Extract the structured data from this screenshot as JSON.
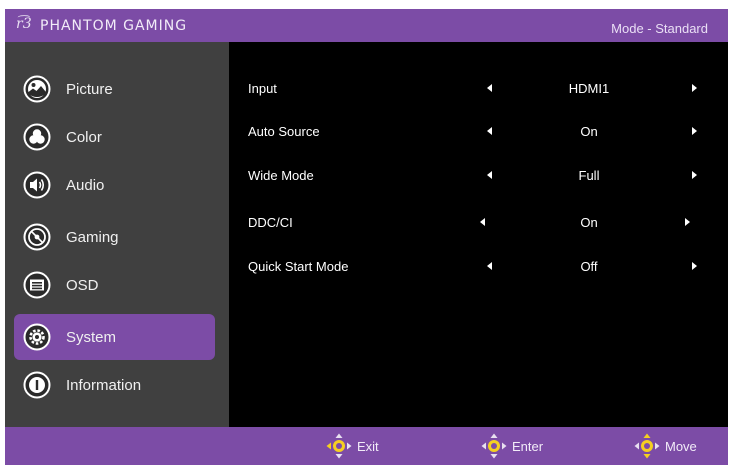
{
  "header": {
    "brand_mark": "r͡3",
    "brand_name": "PHANTOM GAMING",
    "mode": "Mode - Standard"
  },
  "sidebar": {
    "items": [
      {
        "label": "Picture",
        "icon": "picture-icon",
        "active": false
      },
      {
        "label": "Color",
        "icon": "color-icon",
        "active": false
      },
      {
        "label": "Audio",
        "icon": "audio-icon",
        "active": false
      },
      {
        "label": "Gaming",
        "icon": "gaming-icon",
        "active": false
      },
      {
        "label": "OSD",
        "icon": "osd-icon",
        "active": false
      },
      {
        "label": "System",
        "icon": "system-gear-icon",
        "active": true
      },
      {
        "label": "Information",
        "icon": "information-icon",
        "active": false
      }
    ]
  },
  "settings": [
    {
      "label": "Input",
      "value": "HDMI1"
    },
    {
      "label": "Auto Source",
      "value": "On"
    },
    {
      "label": "Wide Mode",
      "value": "Full"
    },
    {
      "label": "DDC/CI",
      "value": "On"
    },
    {
      "label": "Quick Start Mode",
      "value": "Off"
    }
  ],
  "footer": {
    "exit_label": "Exit",
    "enter_label": "Enter",
    "move_label": "Move"
  },
  "colors": {
    "accent": "#7c4ca6",
    "sidebar_bg": "#404040",
    "panel_bg": "#000000",
    "joystick_yellow": "#f5d020"
  }
}
